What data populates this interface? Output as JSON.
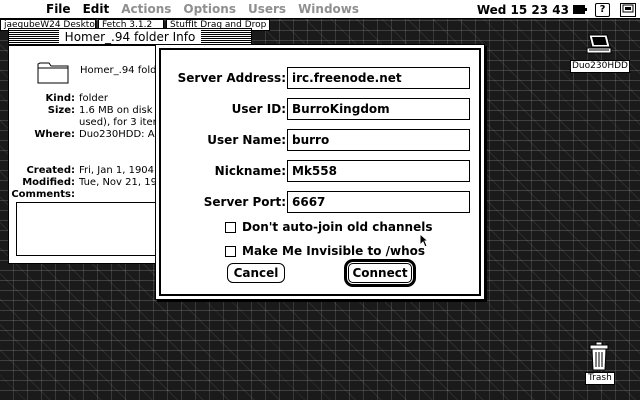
{
  "menubar": {
    "apple_glyph": "",
    "file": "File",
    "edit": "Edit",
    "actions": "Actions",
    "options": "Options",
    "users": "Users",
    "windows": "Windows",
    "clock": "Wed 15 23 43",
    "help_glyph": "?"
  },
  "background_windows": {
    "strip1": "jaegubeW24 Desktop",
    "strip2": "Fetch 3.1.2",
    "strip3": "StuffIt Drag and Drop"
  },
  "info_window": {
    "title": "Homer_.94 folder Info",
    "name": "Homer_.94 folde",
    "kind_label": "Kind:",
    "kind_value": "folder",
    "size_label": "Size:",
    "size_line1": "1.6 MB on disk (",
    "size_line2": "used), for 3 item",
    "where_label": "Where:",
    "where_value": "Duo230HDD: App",
    "created_label": "Created:",
    "created_value": "Fri, Jan 1, 1904",
    "modified_label": "Modified:",
    "modified_value": "Tue, Nov 21, 19",
    "comments_label": "Comments:"
  },
  "dialog": {
    "server_address_label": "Server Address:",
    "server_address_value": "irc.freenode.net",
    "user_id_label": "User ID:",
    "user_id_value": "BurroKingdom",
    "user_name_label": "User Name:",
    "user_name_value": "burro",
    "nickname_label": "Nickname:",
    "nickname_value": "Mk558",
    "server_port_label": "Server Port:",
    "server_port_value": "6667",
    "check_autojoin": "Don't auto-join old channels",
    "check_invisible": "Make Me Invisible to /whos",
    "cancel": "Cancel",
    "connect": "Connect"
  },
  "desktop": {
    "disk_label": "Duo230HDD",
    "trash_label": "Trash"
  }
}
